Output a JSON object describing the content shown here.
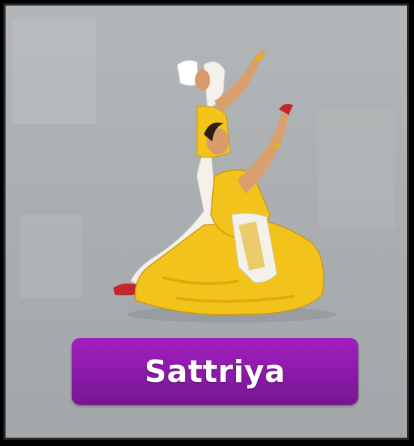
{
  "card": {
    "title_label": "Sattriya",
    "image_icon": "sattriya-dancers-image"
  },
  "colors": {
    "card_background": "#aeb1b4",
    "button": "#9a1db7",
    "button_text": "#ffffff",
    "costume_yellow": "#f2c31a",
    "costume_white": "#f4f1ea"
  }
}
